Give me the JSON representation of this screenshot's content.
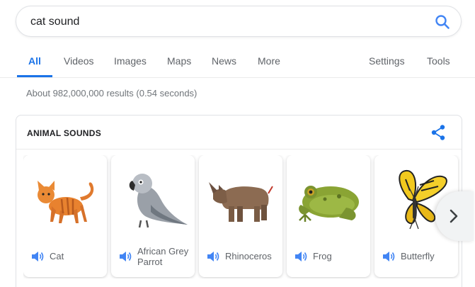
{
  "search": {
    "query": "cat sound"
  },
  "tabs": [
    {
      "label": "All"
    },
    {
      "label": "Videos"
    },
    {
      "label": "Images"
    },
    {
      "label": "Maps"
    },
    {
      "label": "News"
    },
    {
      "label": "More"
    },
    {
      "label": "Settings"
    },
    {
      "label": "Tools"
    }
  ],
  "stats": "About 982,000,000 results (0.54 seconds)",
  "card": {
    "title": "ANIMAL SOUNDS",
    "animals": [
      {
        "label": "Cat"
      },
      {
        "label": "African Grey Parrot"
      },
      {
        "label": "Rhinoceros"
      },
      {
        "label": "Frog"
      },
      {
        "label": "Butterfly"
      }
    ]
  },
  "colors": {
    "accent": "#1a73e8",
    "text_secondary": "#5f6368"
  }
}
